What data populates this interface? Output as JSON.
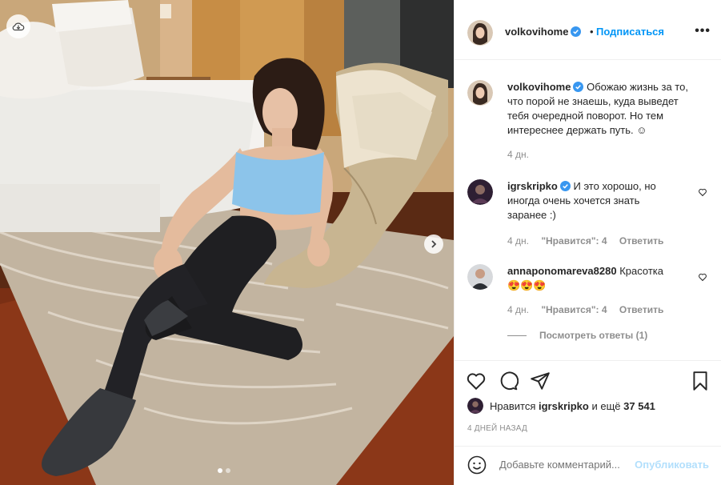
{
  "post": {
    "author": "volkovihome",
    "follow_label": "Подписаться",
    "separator": "•",
    "more_label": "•••",
    "photo_dots": 2,
    "active_dot": 0
  },
  "caption": {
    "author": "volkovihome",
    "text": "Обожаю жизнь за то, что порой не знаешь, куда выведет тебя очередной поворот. Но тем интереснее держать путь. ☺",
    "time": "4 дн."
  },
  "comments": [
    {
      "author": "igrskripko",
      "text": "И это хорошо, но иногда очень хочется знать заранее :)",
      "time": "4 дн.",
      "likes": "\"Нравится\": 4",
      "reply": "Ответить"
    },
    {
      "author": "annaponomareva8280",
      "text": "Красотка 😍😍😍",
      "time": "4 дн.",
      "likes": "\"Нравится\": 4",
      "reply": "Ответить"
    }
  ],
  "replies_label": "Посмотреть ответы (1)",
  "likes": {
    "prefix": "Нравится",
    "user": "igrskripko",
    "and_more": "и ещё",
    "count": "37 541"
  },
  "date": "4 ДНЕЙ НАЗАД",
  "add_comment": {
    "placeholder": "Добавьте комментарий...",
    "post_label": "Опубликовать"
  },
  "colors": {
    "accent": "#0095f6",
    "muted": "#8e8e8e",
    "post_disabled": "#b2dffc"
  }
}
